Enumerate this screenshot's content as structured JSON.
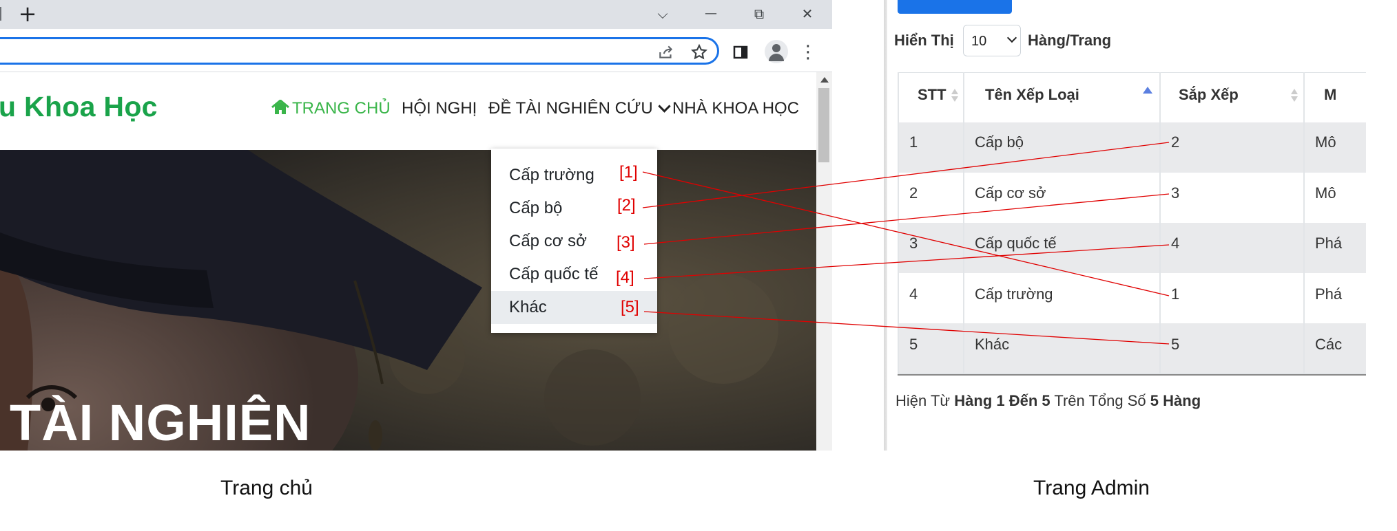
{
  "browser": {
    "new_tab_symbol": "+",
    "window_controls": {
      "tabs_menu": "⌵",
      "minimize": "—",
      "restore": "⧉",
      "close": "✕"
    },
    "toolbar_icons": [
      "share-icon",
      "star-icon",
      "side-panel-icon",
      "profile-icon",
      "kebab-menu-icon"
    ]
  },
  "site": {
    "logo_text": "u Khoa Học",
    "nav": {
      "home": "TRANG CHỦ",
      "conference": "HỘI NGHỊ",
      "topics": "ĐỀ TÀI NGHIÊN CỨU",
      "scientists": "NHÀ KHOA HỌC"
    },
    "hero_title": "TÀI NGHIÊN",
    "dropdown": [
      {
        "label": "Cấp trường",
        "marker": "[1]"
      },
      {
        "label": "Cấp bộ",
        "marker": "[2]"
      },
      {
        "label": "Cấp cơ sở",
        "marker": "[3]"
      },
      {
        "label": "Cấp quốc tế",
        "marker": "[4]"
      },
      {
        "label": "Khác",
        "marker": "[5]"
      }
    ],
    "active_dropdown_item": "Khác"
  },
  "admin": {
    "show_label": "Hiển Thị",
    "page_size": "10",
    "per_page_label": "Hàng/Trang",
    "columns": [
      "STT",
      "Tên Xếp Loại",
      "Sắp Xếp",
      "M"
    ],
    "rows": [
      {
        "stt": "1",
        "name": "Cấp bộ",
        "order": "2",
        "desc": "Mô"
      },
      {
        "stt": "2",
        "name": "Cấp cơ sở",
        "order": "3",
        "desc": "Mô"
      },
      {
        "stt": "3",
        "name": "Cấp quốc tế",
        "order": "4",
        "desc": "Phá"
      },
      {
        "stt": "4",
        "name": "Cấp trường",
        "order": "1",
        "desc": "Phá"
      },
      {
        "stt": "5",
        "name": "Khác",
        "order": "5",
        "desc": "Các"
      }
    ],
    "info": {
      "prefix": "Hiện Từ",
      "range": "Hàng 1 Đến 5",
      "middle": "Trên Tổng Số",
      "total": "5 Hàng"
    }
  },
  "captions": {
    "left": "Trang chủ",
    "right": "Trang Admin"
  },
  "colors": {
    "brand_green": "#1aa34a",
    "nav_active_green": "#3ab54a",
    "omnibox_blue": "#1a73e8",
    "marker_red": "#e00000",
    "sort_blue": "#5b7fe0"
  }
}
